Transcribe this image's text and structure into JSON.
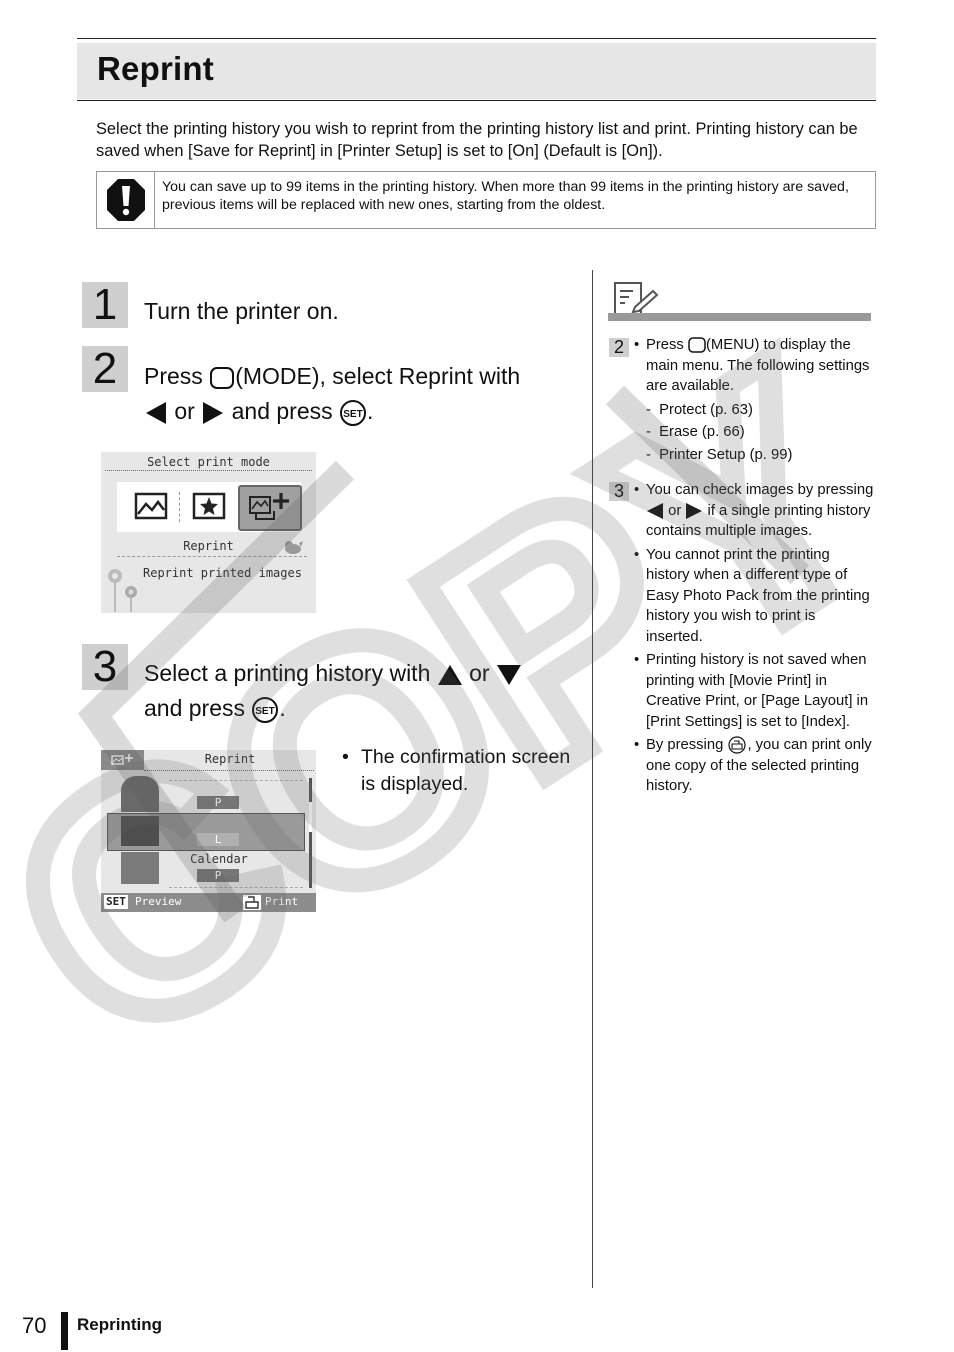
{
  "header": {
    "title": "Reprint"
  },
  "intro": {
    "text": "Select the printing history you wish to reprint from the printing history list and print. Printing history can be saved when [Save for Reprint] in [Printer Setup] is set to [On] (Default is [On])."
  },
  "caution": {
    "icon": "caution-icon",
    "text": "You can save up to 99 items in the printing history. When more than 99 items in the printing history are saved, previous items will be replaced with new ones, starting from the oldest."
  },
  "steps": [
    {
      "number": "1",
      "text": "Turn the printer on."
    },
    {
      "number": "2",
      "parts": [
        "Press",
        "(MODE)",
        ", select Reprint with",
        "or",
        "and press",
        "."
      ]
    },
    {
      "number": "3",
      "parts": [
        "Select a printing history with",
        "or",
        "and press",
        "."
      ],
      "note": "The confirmation screen is displayed."
    }
  ],
  "screen1": {
    "heading": "Select print mode",
    "modes": [
      "photo-mode-icon",
      "creative-mode-icon",
      "reprint-mode-icon"
    ],
    "selected_mode": "Reprint",
    "description": "Reprint printed images"
  },
  "screen2": {
    "heading": "Reprint",
    "items": [
      {
        "label": "",
        "size": "P"
      },
      {
        "label": "",
        "size": "L",
        "selected": true
      },
      {
        "label": "Calendar",
        "size": "P"
      }
    ],
    "footer_left_key": "SET",
    "footer_left": "Preview",
    "footer_right": "Print"
  },
  "memo": {
    "icon": "memo-icon",
    "notes": [
      {
        "step": "2",
        "bullets": [
          {
            "parts": [
              "Press",
              "(MENU)",
              "to display the main menu. The following settings are available."
            ]
          }
        ],
        "sub_items": [
          "Protect (p. 63)",
          "Erase (p. 66)",
          "Printer Setup (p. 99)"
        ]
      },
      {
        "step": "3",
        "bullets": [
          {
            "parts": [
              "You can check images by pressing",
              "or",
              "if a single printing history contains multiple images."
            ]
          },
          {
            "text": "You cannot print the printing history when a different type of Easy Photo Pack from the printing history you wish to print is inserted."
          },
          {
            "text": "Printing history is not saved when printing with [Movie Print] in Creative Print, or [Page Layout] in [Print Settings] is set to [Index]."
          },
          {
            "parts": [
              "By pressing",
              ", you can print only one copy of the selected printing history."
            ]
          }
        ]
      }
    ]
  },
  "footer": {
    "page_number": "70",
    "section": "Reprinting"
  },
  "watermark": {
    "text": "COPY"
  }
}
